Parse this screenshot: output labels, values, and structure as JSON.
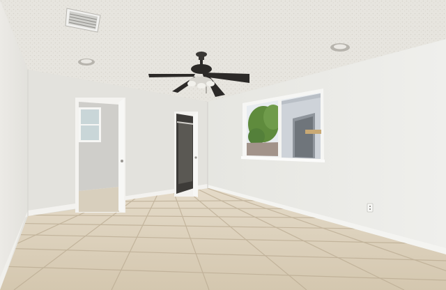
{
  "scene": {
    "kind": "photo-interior",
    "room": "empty bedroom",
    "colors": {
      "ceiling": "#e6e4de",
      "wall_left": "#e9e8e4",
      "wall_back": "#e4e3de",
      "wall_right": "#ebebe7",
      "baseboard": "#f2f2ef",
      "floor_tile": "#d9cdb8",
      "grout": "#b9ab93",
      "fan_dark": "#2c2a28",
      "window_sky": "#e8ecf0",
      "tree": "#5f8b3d",
      "shed": "#ced3d9"
    },
    "objects": [
      "ceiling-fan",
      "hvac-vent",
      "recessed-light-left",
      "recessed-light-right",
      "doorway-to-bathroom",
      "closet-doorway",
      "window",
      "electrical-outlet",
      "tile-floor",
      "baseboard"
    ]
  }
}
